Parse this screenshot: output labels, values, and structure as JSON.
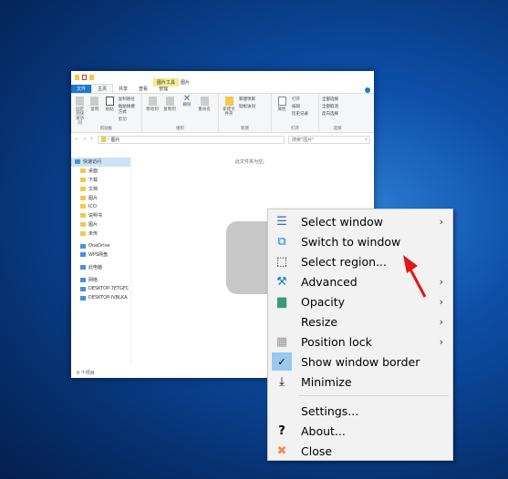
{
  "explorer": {
    "contextual_tab": "图片工具",
    "title": "图片",
    "tabs": [
      "文件",
      "主页",
      "共享",
      "查看",
      "管理"
    ],
    "ribbon": {
      "clipboard": {
        "label": "剪贴板",
        "pin": "固定到快速访问",
        "copy": "复制",
        "paste": "粘贴",
        "copy_path": "复制路径",
        "paste_shortcut": "粘贴快捷方式",
        "cut": "剪切"
      },
      "organize": {
        "label": "组织",
        "move_to": "移动到",
        "copy_to": "复制到",
        "delete": "删除",
        "rename": "重命名"
      },
      "new": {
        "label": "新建",
        "new_folder": "新建文件夹",
        "new_item": "新建项目",
        "easy_access": "轻松访问"
      },
      "open": {
        "label": "打开",
        "properties": "属性",
        "open": "打开",
        "edit": "编辑",
        "history": "历史记录"
      },
      "select": {
        "label": "选择",
        "select_all": "全部选择",
        "select_none": "全部取消",
        "invert": "反向选择"
      }
    },
    "address": "图片",
    "search_placeholder": "搜索\"图片\"",
    "nav": [
      "快速访问",
      "桌面",
      "下载",
      "文档",
      "图片",
      "ICO",
      "说明书",
      "图片",
      "未传",
      "OneDrive",
      "WPS网盘",
      "此电脑",
      "网络",
      "DESKTOP-7ETGFC",
      "DESKTOP-IVBLKA"
    ],
    "empty_text": "此文件夹为空。",
    "status": "0 个项目"
  },
  "menu": {
    "items": [
      {
        "label": "Select window",
        "icon": "window-list-icon",
        "submenu": true
      },
      {
        "label": "Switch to window",
        "icon": "switch-window-icon",
        "submenu": false
      },
      {
        "label": "Select region...",
        "icon": "region-icon",
        "submenu": false
      },
      {
        "label": "Advanced",
        "icon": "tools-icon",
        "submenu": true
      },
      {
        "label": "Opacity",
        "icon": "opacity-icon",
        "submenu": true
      },
      {
        "label": "Resize",
        "icon": "",
        "submenu": true
      },
      {
        "label": "Position lock",
        "icon": "grid-icon",
        "submenu": true
      },
      {
        "label": "Show window border",
        "icon": "check-icon",
        "submenu": false,
        "checked": true
      },
      {
        "label": "Minimize",
        "icon": "minimize-icon",
        "submenu": false
      },
      {
        "label": "Settings...",
        "icon": "",
        "submenu": false
      },
      {
        "label": "About...",
        "icon": "question-icon",
        "submenu": false
      },
      {
        "label": "Close",
        "icon": "close-icon",
        "submenu": false
      }
    ]
  }
}
